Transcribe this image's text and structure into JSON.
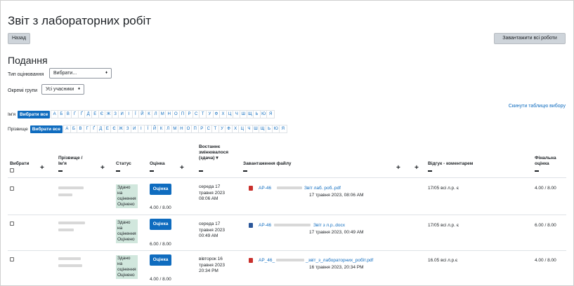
{
  "title": "Звіт з лабораторних робіт",
  "buttons": {
    "back": "Назад",
    "download_all": "Завантажити всі роботи"
  },
  "section_title": "Подання",
  "filters": {
    "grading_type_label": "Тип оцінювання",
    "grading_type_value": "Вибрати...",
    "groups_label": "Окремі групи",
    "groups_value": "Усі учасники"
  },
  "reset_link": "Скинути таблицю вибору",
  "alpha": {
    "firstname_label": "Ім'я",
    "lastname_label": "Прізвище",
    "all_label": "Вибрати все",
    "letters": [
      "А",
      "Б",
      "В",
      "Г",
      "Ґ",
      "Д",
      "Е",
      "Є",
      "Ж",
      "З",
      "И",
      "І",
      "Ї",
      "Й",
      "К",
      "Л",
      "М",
      "Н",
      "О",
      "П",
      "Р",
      "С",
      "Т",
      "У",
      "Ф",
      "Х",
      "Ц",
      "Ч",
      "Ш",
      "Щ",
      "Ь",
      "Ю",
      "Я"
    ]
  },
  "table": {
    "headers": {
      "select": "Вибрати",
      "name_line1": "Прізвище /",
      "name_line2": "Ім'я",
      "status": "Статус",
      "grade": "Оцінка",
      "modified_line1": "Востаннє",
      "modified_line2": "змінювалося",
      "modified_line3": "(здача) ▾",
      "file": "Завантаження файлу",
      "feedback": "Відгук - коментарем",
      "final_line1": "Фінальна",
      "final_line2": "оцінка"
    },
    "rows": [
      {
        "status": [
          "Здано на",
          "оцінення",
          "Оцінено"
        ],
        "grade_button": "Оцінка",
        "grade_value": "4.00 / 8.00",
        "modified": [
          "середа 17",
          "травня 2023",
          "08:06 AM"
        ],
        "file_left": "АР-46",
        "file_right": "Звіт лаб. роб..pdf",
        "file_date": "17 травня 2023, 08:06 AM",
        "file_type": "pdf",
        "feedback": "17/05 всі л.р. є",
        "final": "4.00 / 8.00"
      },
      {
        "status": [
          "Здано на",
          "оцінення",
          "Оцінено"
        ],
        "grade_button": "Оцінка",
        "grade_value": "6.00 / 8.00",
        "modified": [
          "середа 17",
          "травня 2023",
          "00:49 AM"
        ],
        "file_left": "АР-46",
        "file_right": "Звіт з л.р..docx",
        "file_date": "17 травня 2023, 00:49 AM",
        "file_type": "docx",
        "feedback": "17/05 всі л.р. є",
        "final": "6.00 / 8.00"
      },
      {
        "status": [
          "Здано на",
          "оцінення",
          "Оцінено"
        ],
        "grade_button": "Оцінка",
        "grade_value": "4.00 / 8.00",
        "modified": [
          "вівторок 16",
          "травня 2023",
          "20:34 PM"
        ],
        "file_left": "АР_46_",
        "file_right": "_звіт_з_лабораторних_робіт.pdf",
        "file_date": "16 травня 2023, 20:34 PM",
        "file_type": "pdf",
        "feedback": "16.05 всі л.р.є",
        "final": "4.00 / 8.00"
      }
    ]
  },
  "colors": {
    "accent": "#0f6cbf",
    "status_bg": "#d1e7dd",
    "pdf": "#c9302c",
    "docx": "#2b579a"
  }
}
